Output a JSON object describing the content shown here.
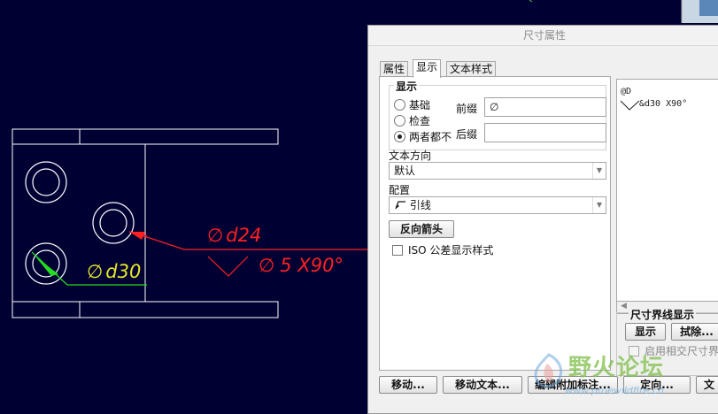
{
  "drawing": {
    "left_dimension": {
      "symbol": "∅",
      "text": "d30"
    },
    "right_dimension": {
      "symbol": "∅",
      "text": "d24"
    },
    "chamfer_dimension": {
      "symbol": "∅",
      "text": "5 X90°"
    }
  },
  "dialog": {
    "title": "尺寸属性",
    "tabs": [
      {
        "label": "属性",
        "active": false
      },
      {
        "label": "显示",
        "active": true
      },
      {
        "label": "文本样式",
        "active": false
      }
    ],
    "display_group": {
      "title": "显示",
      "radio_options": [
        {
          "label": "基础",
          "checked": false
        },
        {
          "label": "检查",
          "checked": false
        },
        {
          "label": "两者都不",
          "checked": true
        }
      ],
      "prefix_label": "前缀",
      "prefix_value": "∅",
      "suffix_label": "后缀",
      "suffix_value": ""
    },
    "text_direction": {
      "label": "文本方向",
      "value": "默认"
    },
    "config": {
      "label": "配置",
      "value": "引线"
    },
    "flip_arrows_button": "反向箭头",
    "iso_checkbox": {
      "label": "ISO 公差显示样式",
      "checked": false
    },
    "dimension_text": [
      "@D",
      "&d30 X90°"
    ],
    "witness_group": {
      "title": "尺寸界线显示",
      "show_button": "显示",
      "erase_button": "拭除...",
      "enable_checkbox_label": "启用相交尺寸界"
    },
    "bottom_buttons": [
      "移动...",
      "移动文本...",
      "编辑附加标注...",
      "定向...",
      "文"
    ]
  },
  "watermark": {
    "text": "野火论坛",
    "url": "www.proewildfire.cn"
  }
}
